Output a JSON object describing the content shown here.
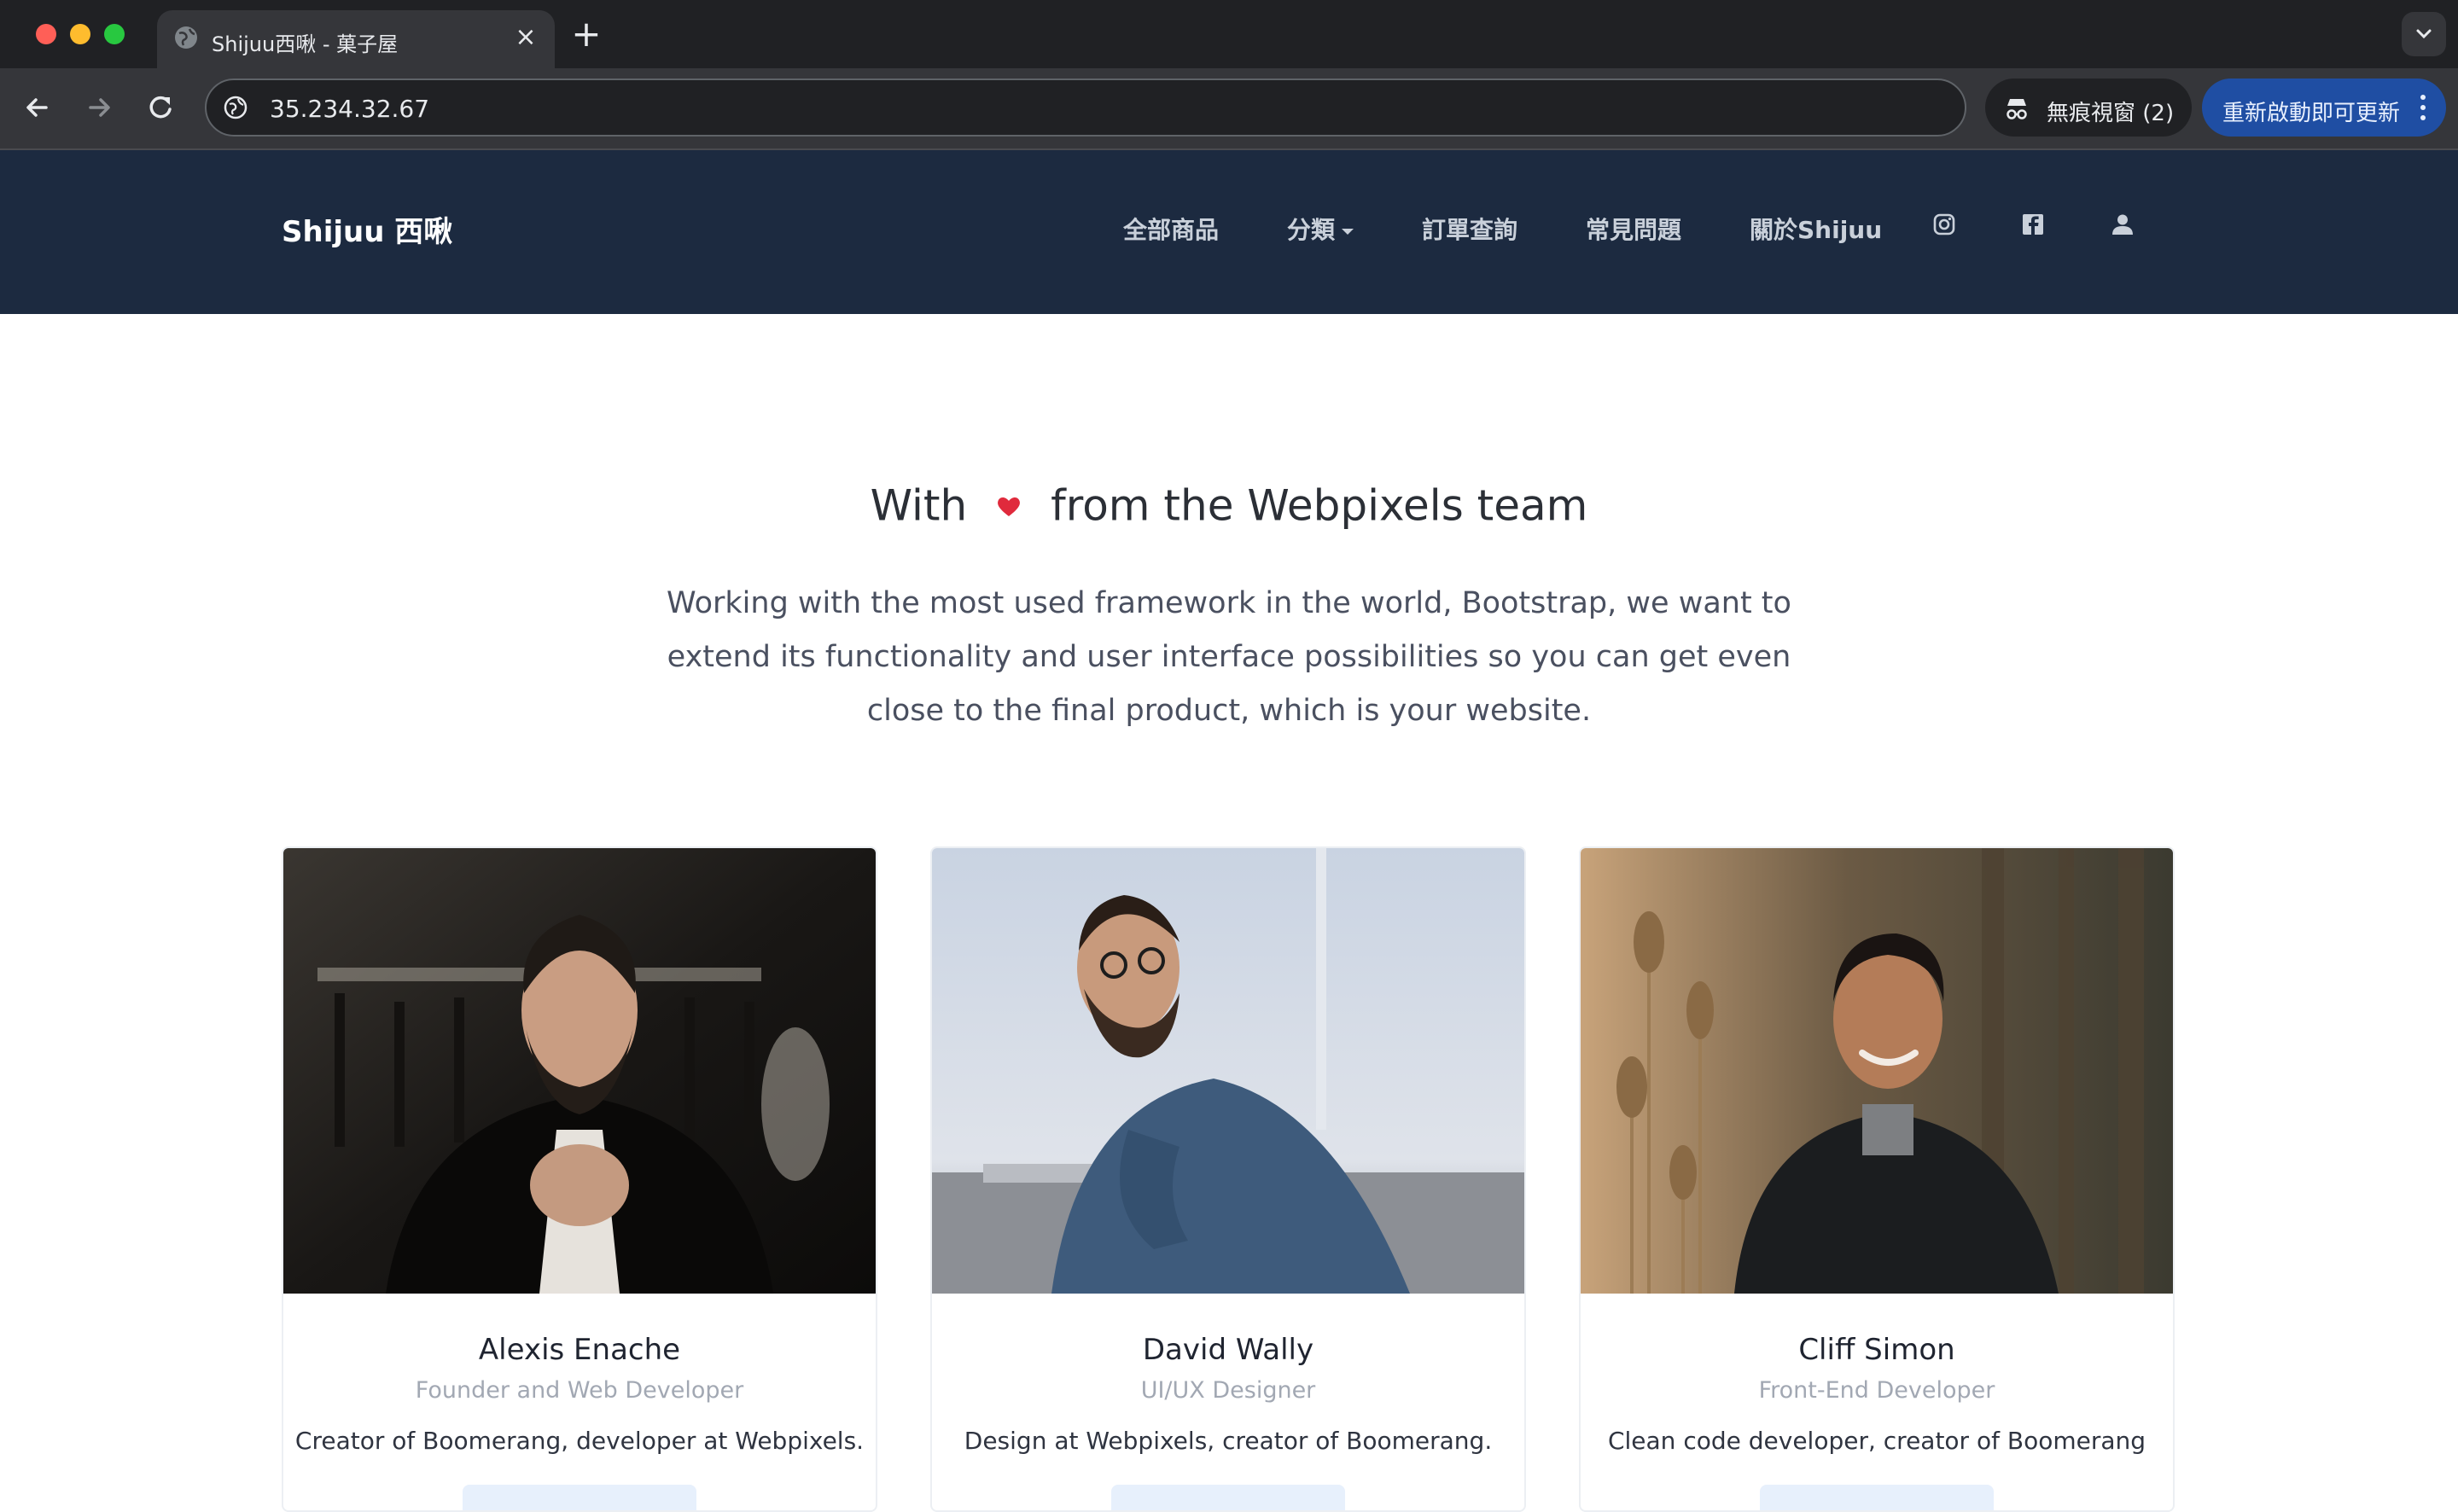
{
  "browser": {
    "tab_title": "Shijuu西啾 - 菓子屋",
    "tab_close": "×",
    "new_tab": "+",
    "url": "35.234.32.67",
    "incognito_label": "無痕視窗 (2)",
    "update_label": "重新啟動即可更新"
  },
  "navbar": {
    "brand": "Shijuu 西啾",
    "links": [
      "全部商品",
      "分類",
      "訂單查詢",
      "常見問題",
      "關於Shijuu"
    ],
    "icons": [
      "instagram-icon",
      "facebook-icon",
      "user-icon"
    ],
    "background": "#1c2a40"
  },
  "hero": {
    "heading_before": "With",
    "heading_after": "from the Webpixels team",
    "heart_color": "#e02a3c",
    "lead": "Working with the most used framework in the world, Bootstrap, we want to extend its functionality and user interface possibilities so you can get even close to the final product, which is your website."
  },
  "team": [
    {
      "name": "Alexis Enache",
      "role": "Founder and Web Developer",
      "bio": "Creator of Boomerang, developer at Webpixels."
    },
    {
      "name": "David Wally",
      "role": "UI/UX Designer",
      "bio": "Design at Webpixels, creator of Boomerang."
    },
    {
      "name": "Cliff Simon",
      "role": "Front-End Developer",
      "bio": "Clean code developer, creator of Boomerang"
    }
  ]
}
